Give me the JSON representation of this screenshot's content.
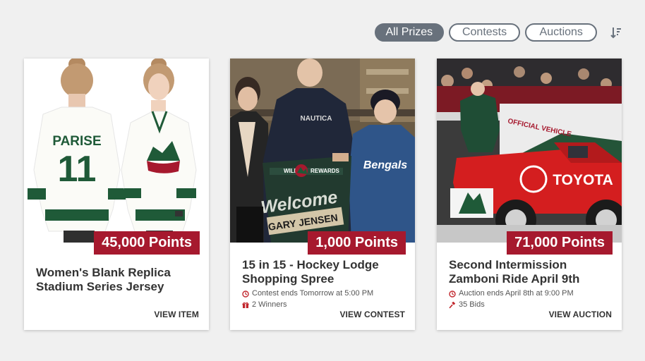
{
  "filters": {
    "all_prizes": "All Prizes",
    "contests": "Contests",
    "auctions": "Auctions"
  },
  "sort_icon": "sort-descending-icon",
  "colors": {
    "accent_red": "#a6192e",
    "pill_gray": "#68717c",
    "card_bg": "#ffffff",
    "page_bg": "#f0f0f0",
    "meta_icon_red": "#c1272d"
  },
  "cards": [
    {
      "points_label": "45,000 Points",
      "title": "Women's Blank Replica Stadium Series Jersey",
      "image_text": {
        "jersey_name": "PARISE",
        "jersey_number": "11"
      },
      "action_label": "VIEW ITEM"
    },
    {
      "points_label": "1,000 Points",
      "title": "15 in 15 - Hockey Lodge Shopping Spree",
      "meta": [
        {
          "icon": "clock-icon",
          "text": "Contest ends Tomorrow at 5:00 PM"
        },
        {
          "icon": "gift-icon",
          "text": "2 Winners"
        }
      ],
      "image_text": {
        "sign_header": "WILD",
        "sign_rewards": "REWARDS",
        "sign_welcome": "Welcome",
        "sign_name": "GARY JENSEN",
        "shirt_text": "NAUTICA",
        "sweatshirt_text": "Bengals"
      },
      "action_label": "VIEW CONTEST"
    },
    {
      "points_label": "71,000 Points",
      "title": "Second Intermission Zamboni Ride April 9th",
      "meta": [
        {
          "icon": "clock-icon",
          "text": "Auction ends April 8th at 9:00 PM"
        },
        {
          "icon": "gavel-icon",
          "text": "35 Bids"
        }
      ],
      "image_text": {
        "brand": "TOYOTA",
        "vehicle_sign": "OFFICIAL VEHICLE"
      },
      "action_label": "VIEW AUCTION"
    }
  ]
}
